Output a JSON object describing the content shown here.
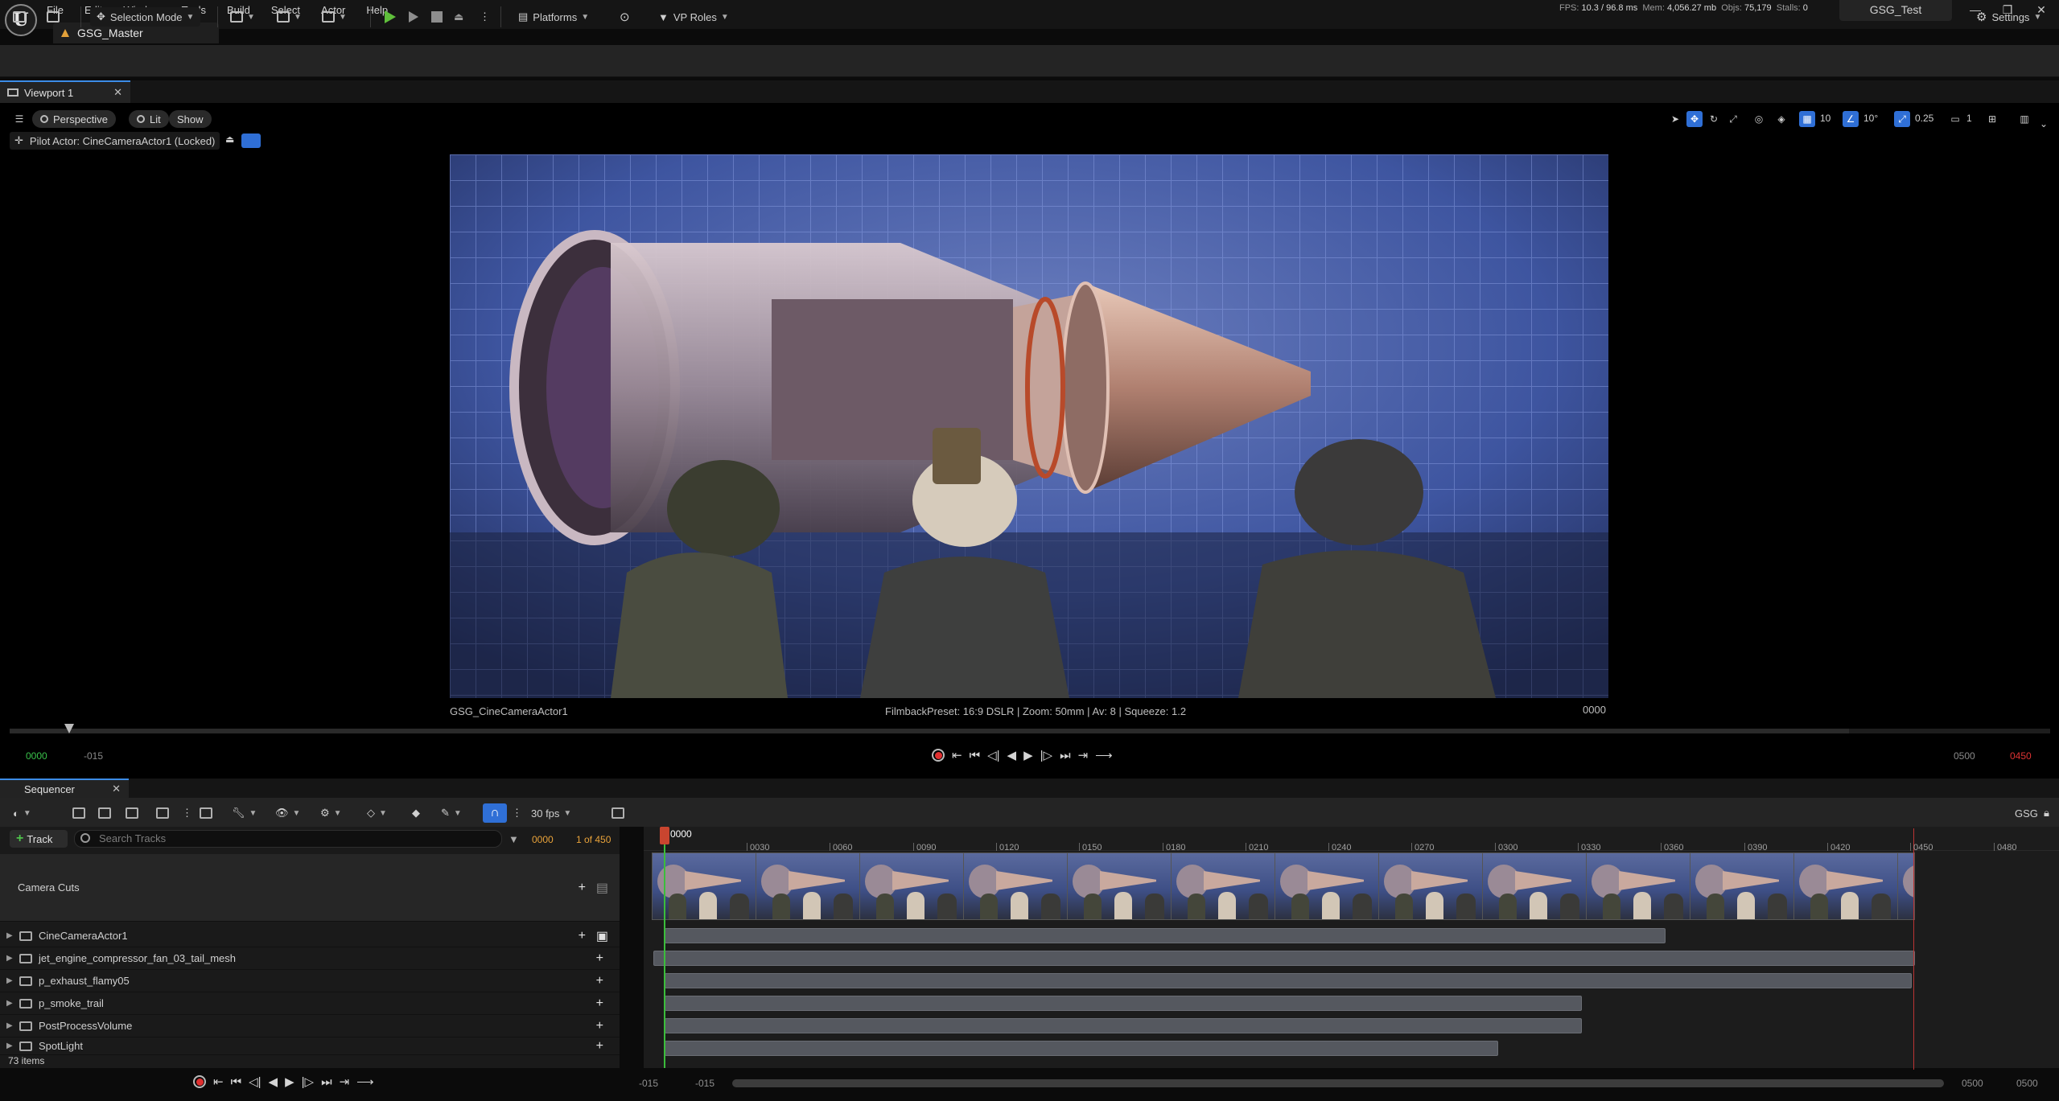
{
  "menu": [
    "File",
    "Edit",
    "Window",
    "Tools",
    "Build",
    "Select",
    "Actor",
    "Help"
  ],
  "stats": {
    "fps_label": "FPS:",
    "fps": "10.3",
    "ms": "/ 96.8 ms",
    "mem_label": "Mem:",
    "mem": "4,056.27 mb",
    "objs_label": "Objs:",
    "objs": "75,179",
    "stalls_label": "Stalls:",
    "stalls": "0"
  },
  "project_name": "GSG_Test",
  "document_tab": "GSG_Master",
  "toolbar": {
    "selection_mode": "Selection Mode",
    "platforms": "Platforms",
    "vp_roles": "VP Roles",
    "settings": "Settings"
  },
  "viewport": {
    "tab": "Viewport 1",
    "perspective": "Perspective",
    "lit": "Lit",
    "show": "Show",
    "pilot": "Pilot Actor: CineCameraActor1 (Locked)",
    "grid_snap": "10",
    "rot_snap": "10°",
    "scale_snap": "0.25",
    "cam_speed": "1",
    "camera_name": "GSG_CineCameraActor1",
    "filmback": "FilmbackPreset: 16:9 DSLR | Zoom: 50mm | Av: 8 | Squeeze: 1.2",
    "frame": "0000",
    "range_start": "0000",
    "range_sub": "-015",
    "range_end": "0500",
    "range_end_red": "0450"
  },
  "sequencer": {
    "tab": "Sequencer",
    "fps": "30 fps",
    "name": "GSG",
    "add_track": "Track",
    "search_placeholder": "Search Tracks",
    "current_frame": "0000",
    "frame_count": "1 of 450",
    "playhead_label": "0000",
    "items_count": "73 items",
    "tracks": [
      "Camera Cuts",
      "CineCameraActor1",
      "jet_engine_compressor_fan_03_tail_mesh",
      "p_exhaust_flamy05",
      "p_smoke_trail",
      "PostProcessVolume",
      "SpotLight"
    ],
    "ruler": [
      "0030",
      "0060",
      "0090",
      "0120",
      "0150",
      "0180",
      "0210",
      "0240",
      "0270",
      "0300",
      "0330",
      "0360",
      "0390",
      "0420",
      "0450",
      "0480"
    ],
    "foot_left1": "-015",
    "foot_left2": "-015",
    "foot_right1": "0500",
    "foot_right2": "0500"
  },
  "colors": {
    "accent": "#2f6fd6",
    "play_green": "#5fbf3b",
    "playhead": "#c9452f",
    "frame_orange": "#e8a23a"
  }
}
